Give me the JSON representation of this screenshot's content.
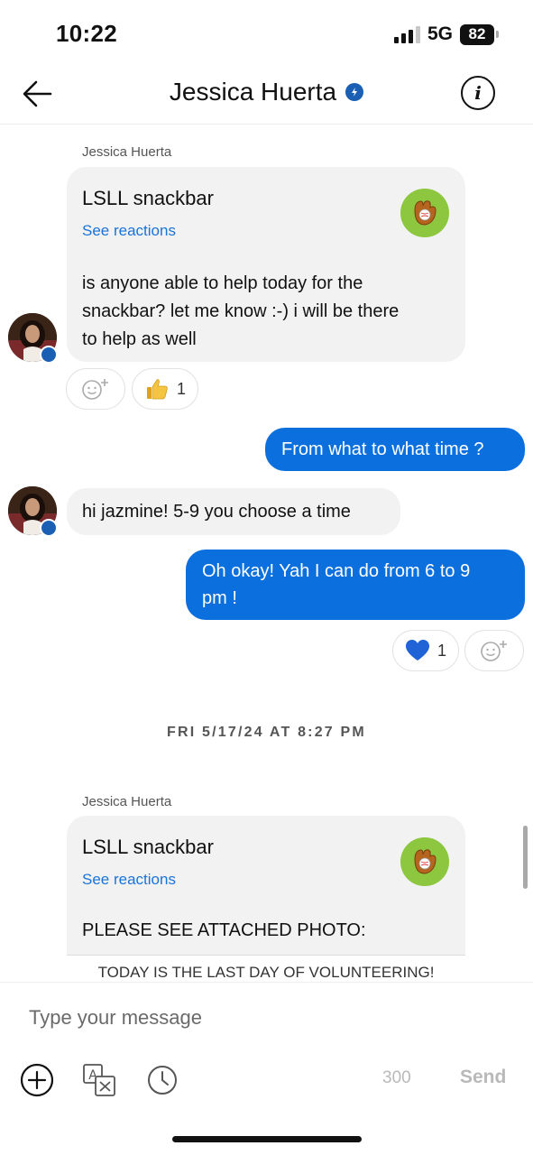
{
  "status_bar": {
    "time": "10:22",
    "network": "5G",
    "battery": "82"
  },
  "header": {
    "title": "Jessica Huerta"
  },
  "messages": {
    "m1": {
      "sender": "Jessica Huerta",
      "group": "LSLL snackbar",
      "see_reactions": "See reactions",
      "line1": "is anyone able to help today for the",
      "line2": "snackbar? let me know :-) i will be there",
      "line3": "to help as well",
      "reaction_count": "1"
    },
    "m2": {
      "text": "From what to what time ?"
    },
    "m3": {
      "text": "hi jazmine! 5-9 you choose a time"
    },
    "m4": {
      "line1": "Oh okay! Yah I can do from 6 to 9",
      "line2": "pm !",
      "reaction_count": "1"
    },
    "date_separator": "FRI 5/17/24 AT 8:27 PM",
    "m5": {
      "sender": "Jessica Huerta",
      "group": "LSLL snackbar",
      "see_reactions": "See reactions",
      "text": "PLEASE SEE ATTACHED PHOTO:",
      "attachment_preview": "TODAY IS THE LAST DAY OF VOLUNTEERING!"
    }
  },
  "composer": {
    "placeholder": "Type your message",
    "char_count": "300",
    "send_label": "Send"
  }
}
